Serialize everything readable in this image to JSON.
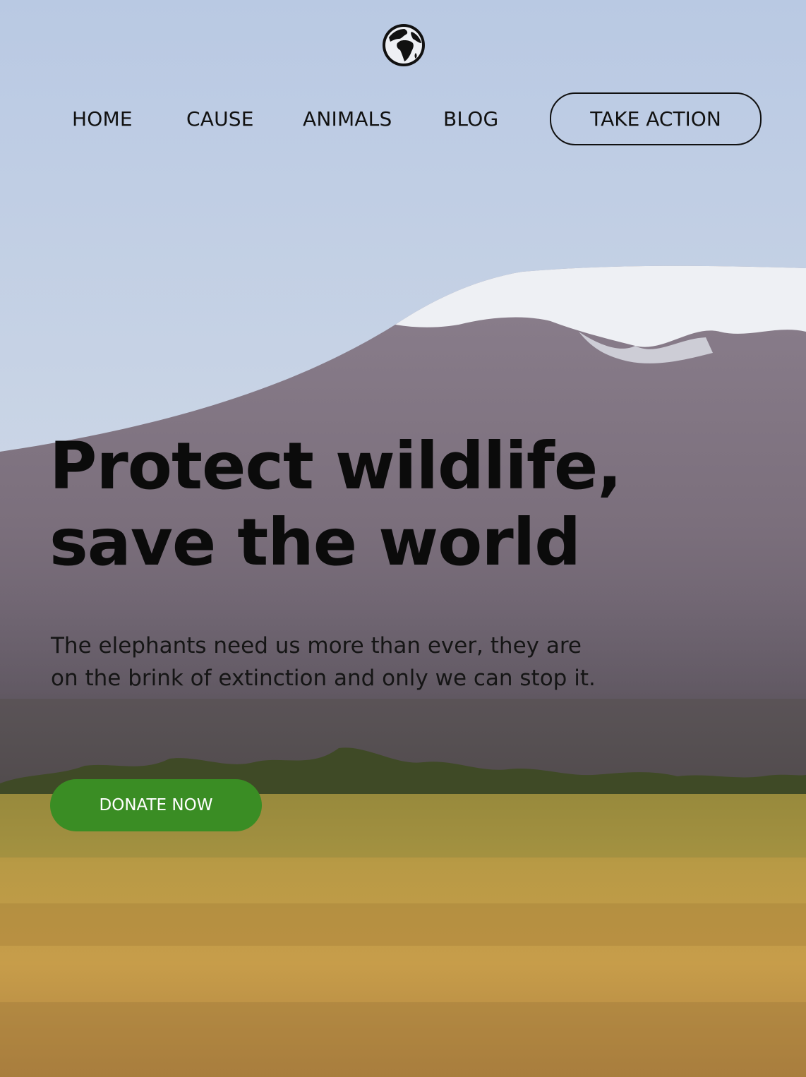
{
  "nav": {
    "logo_icon": "globe-africa-icon",
    "links": [
      {
        "label": "HOME"
      },
      {
        "label": "CAUSE"
      },
      {
        "label": "ANIMALS"
      },
      {
        "label": "BLOG"
      }
    ],
    "cta_label": "TAKE ACTION"
  },
  "hero": {
    "headline_line1": "Protect wildlife,",
    "headline_line2": "save the world",
    "subtext_line1": "The elephants need us more than ever, they are",
    "subtext_line2": "on the brink of extinction and only we can stop it.",
    "donate_label": "DONATE NOW"
  },
  "colors": {
    "donate_bg": "#3a8d24",
    "text": "#111111"
  }
}
